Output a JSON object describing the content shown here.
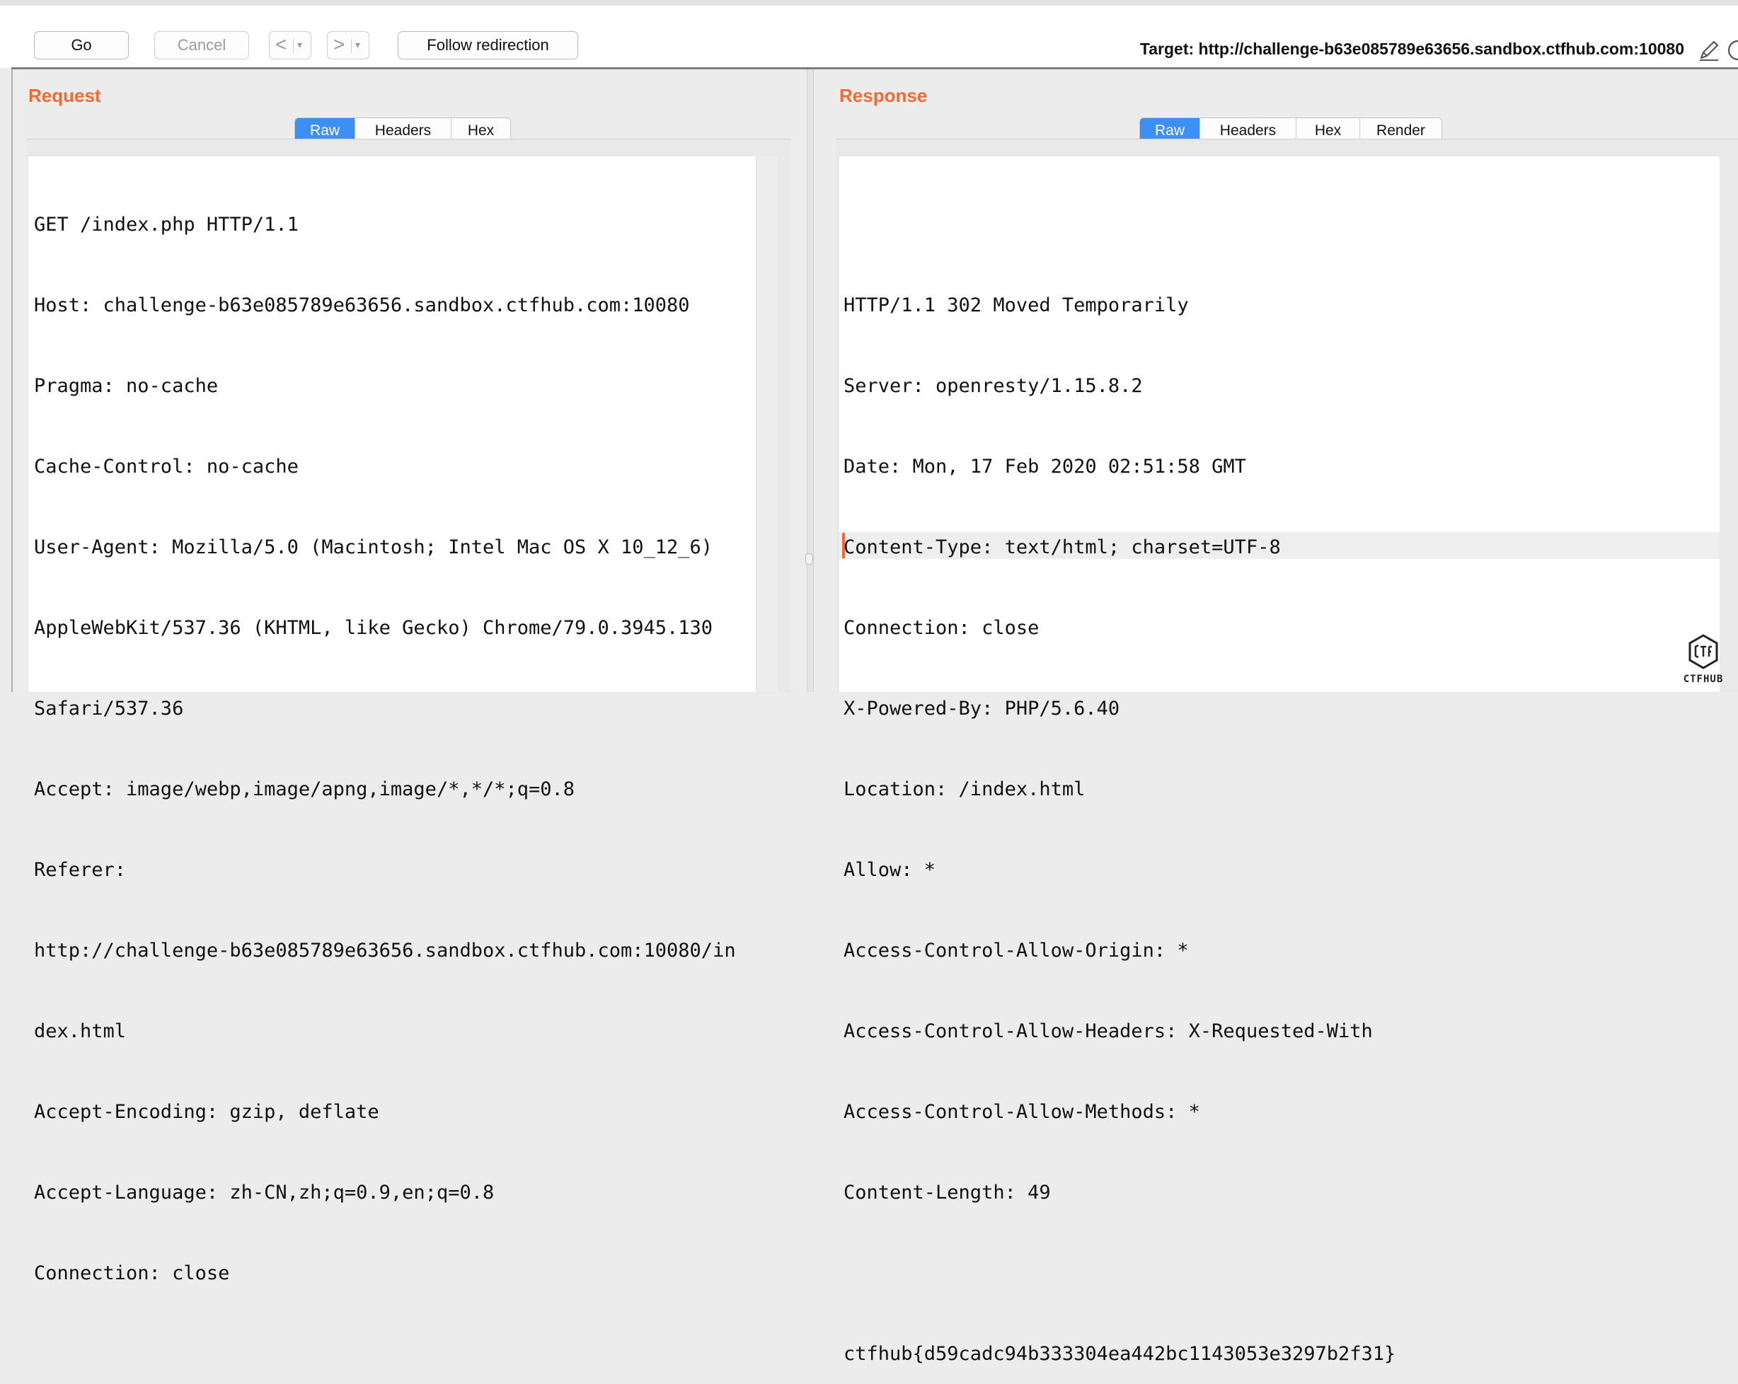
{
  "toolbar": {
    "go_label": "Go",
    "cancel_label": "Cancel",
    "back_glyph": "<",
    "forward_glyph": ">",
    "dropdown_glyph": "▾",
    "follow_redirection_label": "Follow redirection",
    "target_text": "Target: http://challenge-b63e085789e63656.sandbox.ctfhub.com:10080",
    "icons": [
      "pencil-icon",
      "help-circle-icon"
    ]
  },
  "request": {
    "title": "Request",
    "tabs": [
      {
        "label": "Raw",
        "active": true
      },
      {
        "label": "Headers",
        "active": false
      },
      {
        "label": "Hex",
        "active": false
      }
    ],
    "lines": [
      "GET /index.php HTTP/1.1",
      "Host: challenge-b63e085789e63656.sandbox.ctfhub.com:10080",
      "Pragma: no-cache",
      "Cache-Control: no-cache",
      "User-Agent: Mozilla/5.0 (Macintosh; Intel Mac OS X 10_12_6)",
      "AppleWebKit/537.36 (KHTML, like Gecko) Chrome/79.0.3945.130",
      "Safari/537.36",
      "Accept: image/webp,image/apng,image/*,*/*;q=0.8",
      "Referer:",
      "http://challenge-b63e085789e63656.sandbox.ctfhub.com:10080/in",
      "dex.html",
      "Accept-Encoding: gzip, deflate",
      "Accept-Language: zh-CN,zh;q=0.9,en;q=0.8",
      "Connection: close"
    ]
  },
  "response": {
    "title": "Response",
    "tabs": [
      {
        "label": "Raw",
        "active": true
      },
      {
        "label": "Headers",
        "active": false
      },
      {
        "label": "Hex",
        "active": false
      },
      {
        "label": "Render",
        "active": false
      }
    ],
    "lines": [
      "HTTP/1.1 302 Moved Temporarily",
      "Server: openresty/1.15.8.2",
      "Date: Mon, 17 Feb 2020 02:51:58 GMT",
      "Content-Type: text/html; charset=UTF-8",
      "Connection: close",
      "X-Powered-By: PHP/5.6.40",
      "Location: /index.html",
      "Allow: *",
      "Access-Control-Allow-Origin: *",
      "Access-Control-Allow-Headers: X-Requested-With",
      "Access-Control-Allow-Methods: *",
      "Content-Length: 49",
      "",
      "ctfhub{d59cadc94b333304ea442bc1143053e3297b2f31}"
    ]
  },
  "watermark": {
    "text": "CTFHUB",
    "icon": "ctfhub-logo-icon"
  },
  "colors": {
    "accent_title": "#f06a35",
    "active_tab": "#3d8ff5",
    "caret": "#f06a35"
  }
}
